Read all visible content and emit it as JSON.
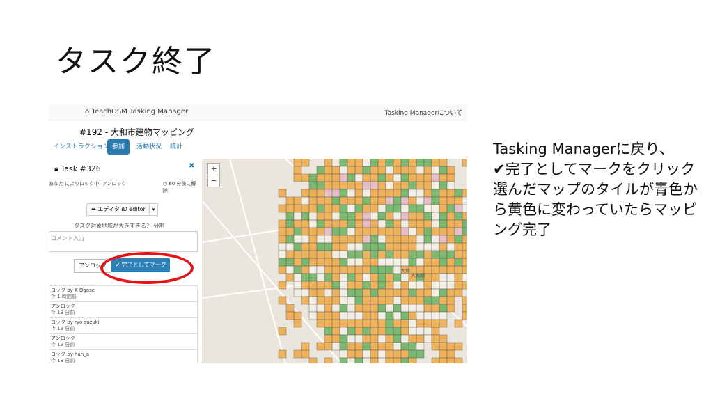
{
  "slide": {
    "title": "タスク終了",
    "note": "Tasking Managerに戻り、\n✔完了としてマークをクリック\n選んだマップのタイルが青色から黄色に変わっていたらマッピング完了"
  },
  "app": {
    "brand": "TeachOSM Tasking Manager",
    "about_link": "Tasking Managerについて",
    "project_title": "#192 - 大和市建物マッピング",
    "tabs": [
      "インストラクション",
      "参加",
      "活動状況",
      "統計"
    ],
    "active_tab": "参加"
  },
  "task": {
    "title": "Task #326",
    "lock_status": "あなた によりロック中: アンロック",
    "timer": "60 分後に解除",
    "editor_button": "エディタ iD editor",
    "split_hint": "タスク対象地域が大きすぎる？ 分割",
    "comment_placeholder": "コメント入力",
    "unlock_button": "アンロック",
    "mark_done_button": "✔ 完了としてマーク"
  },
  "history": [
    {
      "action": "ロック by K Ogose",
      "time": "今 1 時間前"
    },
    {
      "action": "アンロック",
      "time": "今 13 日前"
    },
    {
      "action": "ロック by ryo suzuki",
      "time": "今 13 日前"
    },
    {
      "action": "アンロック",
      "time": "今 13 日前"
    },
    {
      "action": "ロック by han_a",
      "time": "今 13 日前"
    }
  ],
  "map": {
    "zoom_in": "+",
    "zoom_out": "−",
    "place_labels": [
      "大和",
      "大和駅"
    ],
    "tile_colors": {
      "done": "#f0a030",
      "validated": "#55a84b",
      "locked": "#e6b0c0",
      "empty": "#f5f0e6"
    }
  },
  "colors": {
    "accent": "#2a7ab0",
    "highlight": "#e31217"
  }
}
